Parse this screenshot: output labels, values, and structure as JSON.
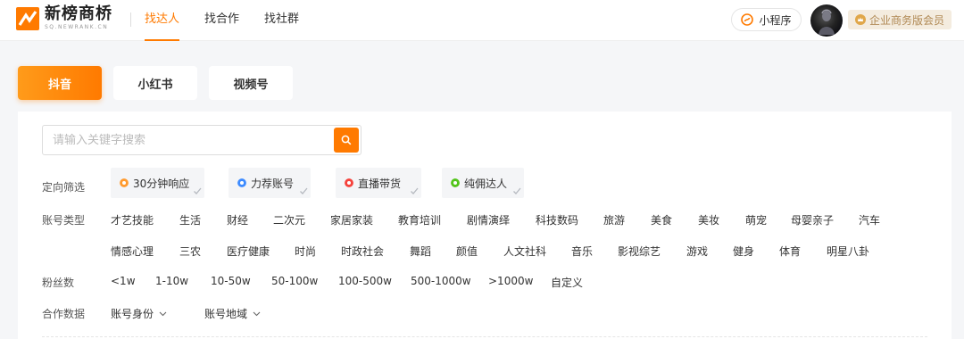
{
  "header": {
    "logo_cn": "新榜商桥",
    "logo_en": "SQ.NEWRANK.CN",
    "nav": [
      "找达人",
      "找合作",
      "找社群"
    ],
    "mini_program": "小程序",
    "vip_label": "企业商务版会员"
  },
  "platform_tabs": [
    "抖音",
    "小红书",
    "视频号"
  ],
  "search": {
    "placeholder": "请输入关键字搜索"
  },
  "filters": {
    "targeted_label": "定向筛选",
    "targeted_chips": [
      {
        "label": "30分钟响应",
        "icon": "clock-icon",
        "color": "#ff9a2e"
      },
      {
        "label": "力荐账号",
        "icon": "thumb-up-icon",
        "color": "#3d8bff"
      },
      {
        "label": "直播带货",
        "icon": "live-icon",
        "color": "#f5423c"
      },
      {
        "label": "纯佣达人",
        "icon": "leaf-icon",
        "color": "#52c41a"
      }
    ],
    "account_type_label": "账号类型",
    "account_types_row1": [
      "才艺技能",
      "生活",
      "财经",
      "二次元",
      "家居家装",
      "教育培训",
      "剧情演绎",
      "科技数码",
      "旅游",
      "美食",
      "美妆",
      "萌宠",
      "母婴亲子",
      "汽车"
    ],
    "account_types_row2": [
      "情感心理",
      "三农",
      "医疗健康",
      "时尚",
      "时政社会",
      "舞蹈",
      "颜值",
      "人文社科",
      "音乐",
      "影视综艺",
      "游戏",
      "健身",
      "体育",
      "明星八卦"
    ],
    "fans_label": "粉丝数",
    "fans": [
      "<1w",
      "1-10w",
      "10-50w",
      "50-100w",
      "100-500w",
      "500-1000w",
      ">1000w",
      "自定义"
    ],
    "coop_label": "合作数据",
    "coop_dropdowns": [
      "账号身份",
      "账号地域"
    ]
  },
  "colors": {
    "accent": "#ff7a00",
    "vip_text": "#b08954"
  }
}
